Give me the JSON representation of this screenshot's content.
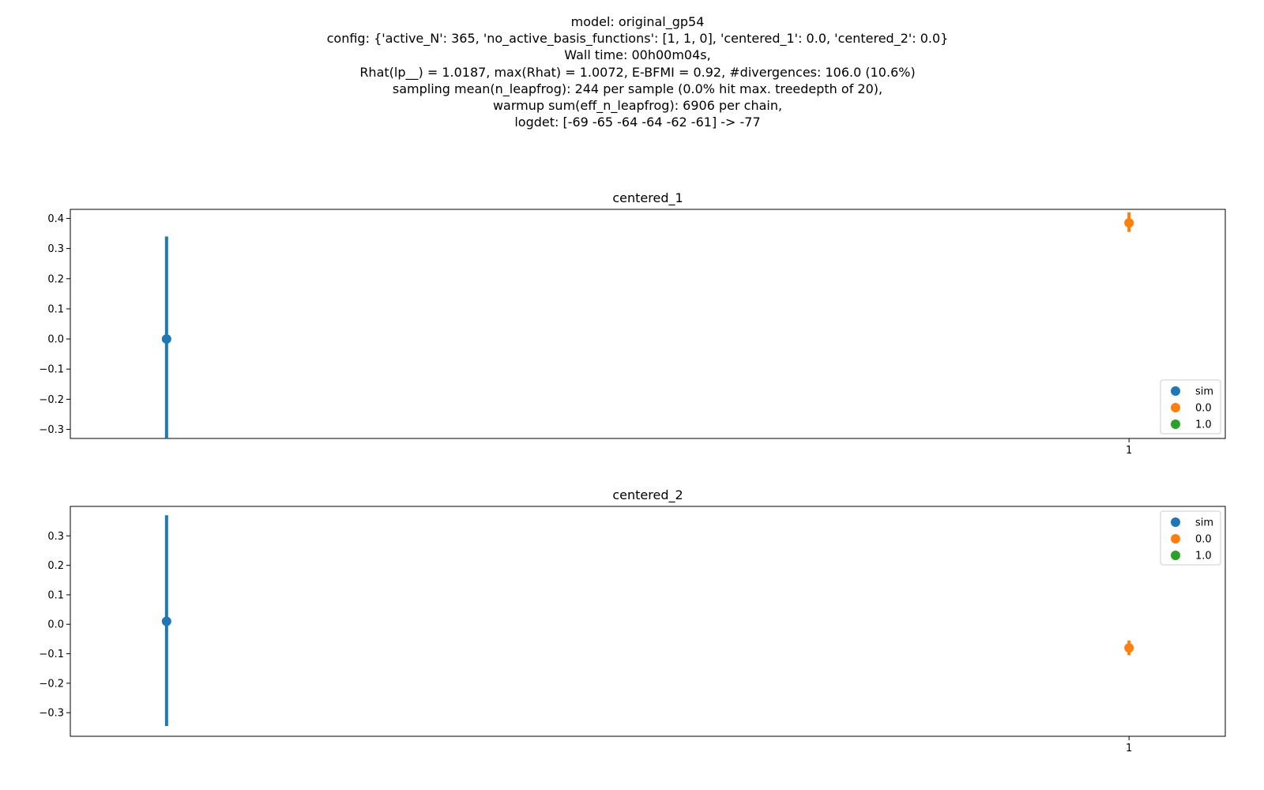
{
  "suptitle_lines": [
    "model: original_gp54",
    "config: {'active_N': 365, 'no_active_basis_functions': [1, 1, 0], 'centered_1': 0.0, 'centered_2': 0.0}",
    "Wall time: 00h00m04s,",
    "Rhat(lp__) = 1.0187, max(Rhat) = 1.0072, E-BFMI = 0.92, #divergences: 106.0 (10.6%)",
    "sampling mean(n_leapfrog): 244 per sample (0.0% hit max. treedepth of 20),",
    "warmup sum(eff_n_leapfrog): 6906 per chain,",
    "logdet: [-69 -65 -64 -64 -62 -61] -> -77"
  ],
  "colors": {
    "sim": "#1f77b4",
    "0.0": "#ff7f0e",
    "1.0": "#2ca02c"
  },
  "chart_data": [
    {
      "type": "scatter",
      "title": "centered_1",
      "xlabel": "",
      "ylabel": "",
      "x_ticks": [
        "1"
      ],
      "y_ticks": [
        -0.3,
        -0.2,
        -0.1,
        0.0,
        0.1,
        0.2,
        0.3,
        0.4
      ],
      "ylim": [
        -0.33,
        0.43
      ],
      "xlim": [
        -0.1,
        1.1
      ],
      "legend": {
        "location": "lower right",
        "entries": [
          "sim",
          "0.0",
          "1.0"
        ]
      },
      "series": [
        {
          "name": "sim",
          "points": [
            {
              "x": 0,
              "y": 0.0,
              "low": -0.33,
              "high": 0.34
            }
          ]
        },
        {
          "name": "0.0",
          "points": [
            {
              "x": 1,
              "y": 0.385,
              "low": 0.355,
              "high": 0.42
            }
          ]
        },
        {
          "name": "1.0",
          "points": []
        }
      ]
    },
    {
      "type": "scatter",
      "title": "centered_2",
      "xlabel": "",
      "ylabel": "",
      "x_ticks": [
        "1"
      ],
      "y_ticks": [
        -0.3,
        -0.2,
        -0.1,
        0.0,
        0.1,
        0.2,
        0.3
      ],
      "ylim": [
        -0.38,
        0.4
      ],
      "xlim": [
        -0.1,
        1.1
      ],
      "legend": {
        "location": "upper right",
        "entries": [
          "sim",
          "0.0",
          "1.0"
        ]
      },
      "series": [
        {
          "name": "sim",
          "points": [
            {
              "x": 0,
              "y": 0.01,
              "low": -0.345,
              "high": 0.37
            }
          ]
        },
        {
          "name": "0.0",
          "points": [
            {
              "x": 1,
              "y": -0.08,
              "low": -0.105,
              "high": -0.055
            }
          ]
        },
        {
          "name": "1.0",
          "points": []
        }
      ]
    }
  ]
}
